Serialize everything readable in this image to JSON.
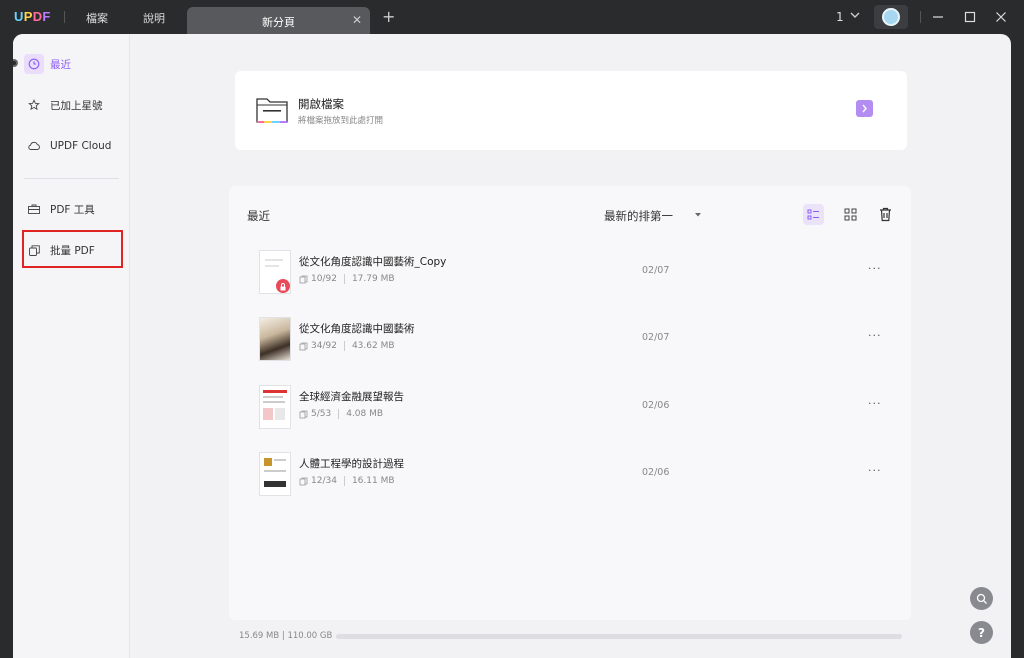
{
  "titlebar": {
    "logo": [
      "U",
      "P",
      "D",
      "F"
    ],
    "menu_file": "檔案",
    "menu_help": "說明",
    "tab_label": "新分頁",
    "tab_close": "✕",
    "tab_add": "+",
    "page_number": "1"
  },
  "sidebar": {
    "items": [
      {
        "label": "最近",
        "icon": "clock-icon"
      },
      {
        "label": "已加上星號",
        "icon": "star-icon"
      },
      {
        "label": "UPDF Cloud",
        "icon": "cloud-icon"
      },
      {
        "label": "PDF 工具",
        "icon": "toolbox-icon"
      },
      {
        "label": "批量 PDF",
        "icon": "batch-icon"
      }
    ]
  },
  "open_card": {
    "title": "開啟檔案",
    "subtitle": "將檔案拖放到此處打開"
  },
  "recent": {
    "title": "最近",
    "sort_label": "最新的排第一",
    "files": [
      {
        "name": "從文化角度認識中國藝術_Copy",
        "pages": "10/92",
        "size": "17.79 MB",
        "date": "02/07",
        "more": "···"
      },
      {
        "name": "從文化角度認識中國藝術",
        "pages": "34/92",
        "size": "43.62 MB",
        "date": "02/07",
        "more": "···"
      },
      {
        "name": "全球經濟金融展望報告",
        "pages": "5/53",
        "size": "4.08 MB",
        "date": "02/06",
        "more": "···"
      },
      {
        "name": "人體工程學的設計過程",
        "pages": "12/34",
        "size": "16.11 MB",
        "date": "02/06",
        "more": "···"
      }
    ]
  },
  "storage": {
    "text": "15.69 MB | 110.00 GB",
    "used_fraction": 0.0001
  },
  "floating": {
    "help_label": "?"
  },
  "colors": {
    "accent": "#8b5cf6",
    "highlight_box": "#e02424",
    "lock_badge": "#e84a5a"
  }
}
